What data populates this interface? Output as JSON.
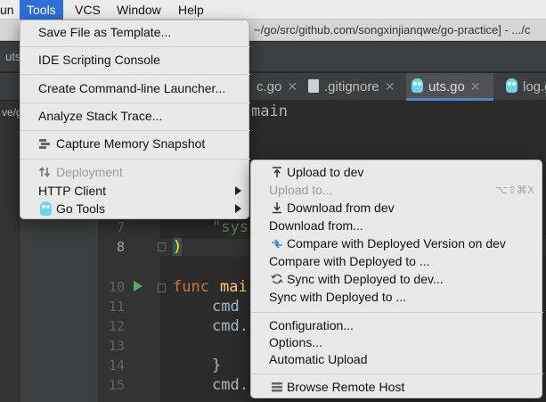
{
  "menubar": {
    "items": [
      "un",
      "Tools",
      "VCS",
      "Window",
      "Help"
    ]
  },
  "titlebar": {
    "path": "~/go/src/github.com/songxinjianqwe/go-practice] - .../c"
  },
  "navbar": {
    "crumb": "uts"
  },
  "sidebar": {
    "vertical_label": "ve/g"
  },
  "tabs": [
    {
      "label": "c.go"
    },
    {
      "label": ".gitignore"
    },
    {
      "label": "uts.go"
    },
    {
      "label": "log.g"
    }
  ],
  "editor": {
    "line_numbers": [
      "7",
      "8",
      "10",
      "11",
      "12",
      "13",
      "14",
      "15"
    ],
    "lines": {
      "main": "main",
      "sys": "\"sys",
      "paren": ")",
      "func": "func",
      "func_name": "mai",
      "cmd1": "cmd",
      "cmd2": "cmd.",
      "brace": "}",
      "cmd3": "cmd."
    }
  },
  "tools_menu": {
    "items": {
      "save_template": "Save File as Template...",
      "ide_console": "IDE Scripting Console",
      "cli_launcher": "Create Command-line Launcher...",
      "analyze_trace": "Analyze Stack Trace...",
      "memory_snapshot": "Capture Memory Snapshot",
      "deployment": "Deployment",
      "http_client": "HTTP Client",
      "go_tools": "Go Tools"
    }
  },
  "deployment_menu": {
    "items": {
      "upload_to_dev": "Upload to dev",
      "upload_to": "Upload to...",
      "upload_to_shortcut": "⌥⇧⌘X",
      "download_from_dev": "Download from dev",
      "download_from": "Download from...",
      "compare_deployed": "Compare with Deployed Version on dev",
      "compare_deployed_to": "Compare with Deployed to ...",
      "sync_dev": "Sync with Deployed to dev...",
      "sync_to": "Sync with Deployed to ...",
      "configuration": "Configuration...",
      "options": "Options...",
      "auto_upload": "Automatic Upload",
      "browse_remote": "Browse Remote Host"
    }
  },
  "colors": {
    "menu_highlight": "#2f6fd6",
    "editor_bg": "#2b2b2b",
    "keyword": "#cc7832",
    "string": "#6a8759"
  }
}
